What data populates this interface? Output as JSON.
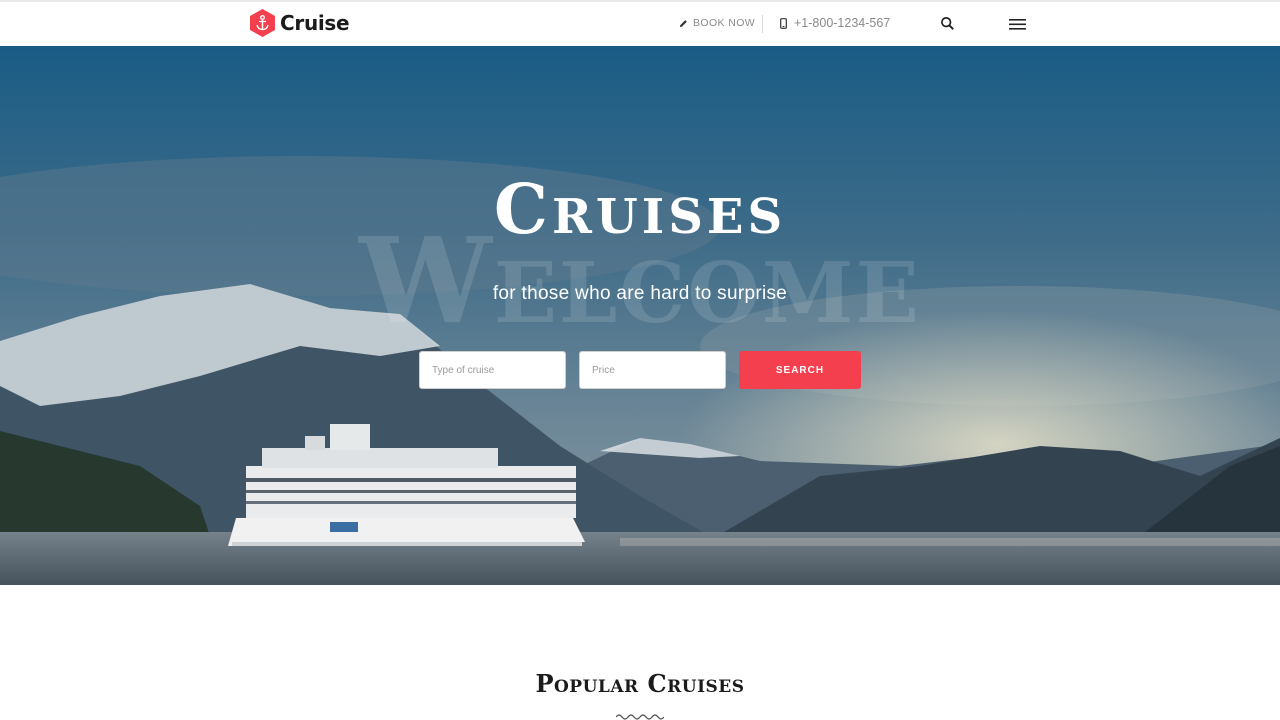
{
  "header": {
    "logo_text": "Cruise",
    "book_label": "BOOK NOW",
    "phone": "+1-800-1234-567",
    "icons": [
      "anchor-logo-icon",
      "pencil-icon",
      "mobile-phone-icon",
      "search-icon",
      "hamburger-menu-icon"
    ]
  },
  "hero": {
    "watermark": "Welcome",
    "title": "Cruises",
    "subtitle": "for those who are hard to surprise",
    "type_placeholder": "Type of cruise",
    "price_placeholder": "Price",
    "search_label": "SEARCH"
  },
  "popular": {
    "title": "Popular Cruises"
  },
  "colors": {
    "accent": "#f4404e",
    "sky_top": "#1f5f86",
    "water": "#5c6a76"
  }
}
